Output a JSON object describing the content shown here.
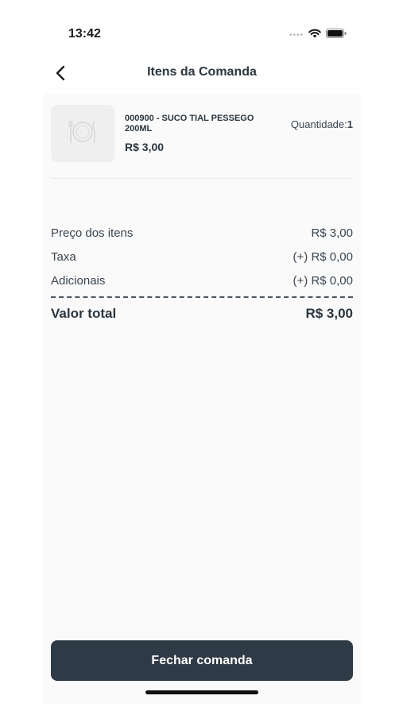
{
  "status_bar": {
    "time": "13:42",
    "signal_icon": "signal-dots-icon",
    "wifi_icon": "wifi-icon",
    "battery_icon": "battery-icon"
  },
  "header": {
    "back_icon": "chevron-left-icon",
    "title": "Itens da Comanda"
  },
  "item": {
    "image_icon": "plate-cutlery-icon",
    "name": "000900 - SUCO TIAL PESSEGO 200ML",
    "price": "R$ 3,00",
    "quantity_label": "Quantidade:",
    "quantity_value": "1"
  },
  "summary": {
    "rows": [
      {
        "label": "Preço dos itens",
        "value": "R$ 3,00"
      },
      {
        "label": "Taxa",
        "value": "(+) R$ 0,00"
      },
      {
        "label": "Adicionais",
        "value": "(+) R$ 0,00"
      }
    ],
    "total_label": "Valor total",
    "total_value": "R$ 3,00"
  },
  "actions": {
    "close_label": "Fechar comanda"
  },
  "colors": {
    "primary": "#2e3a45",
    "text": "#2b3640",
    "screen_bg": "#fafafa"
  }
}
